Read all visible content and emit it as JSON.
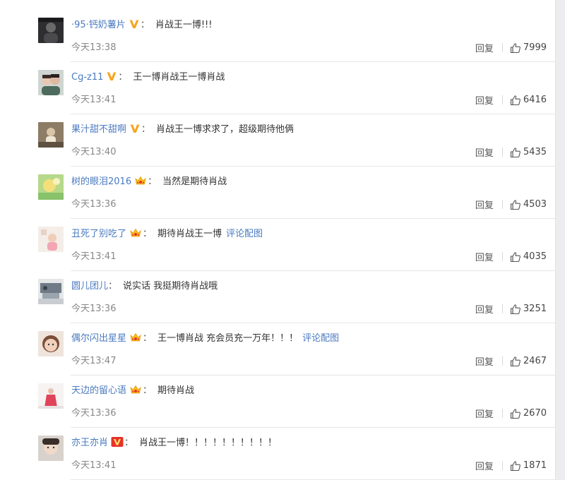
{
  "colors": {
    "link": "#4a7ac0",
    "vip_orange": "#f5a623",
    "vip_red": "#e8312a"
  },
  "icons": [
    "v-badge-icon",
    "crown-badge-icon",
    "v-red-badge-icon",
    "thumbs-up-icon"
  ],
  "actions": {
    "reply_label": "回复"
  },
  "comments": [
    {
      "username": "·95·钙奶薯片",
      "badge": "v-orange",
      "text": "肖战王一博!!!",
      "pic_link": "",
      "time": "今天13:38",
      "likes": "7999",
      "avatar": "dark"
    },
    {
      "username": "Cg-z11",
      "badge": "v-orange",
      "text": "王一博肖战王一博肖战",
      "pic_link": "",
      "time": "今天13:41",
      "likes": "6416",
      "avatar": "couple"
    },
    {
      "username": "果汁甜不甜啊",
      "badge": "v-orange",
      "text": "肖战王一博求求了，超级期待他俩",
      "pic_link": "",
      "time": "今天13:40",
      "likes": "5435",
      "avatar": "sepia"
    },
    {
      "username": "树的眼泪2016",
      "badge": "crown",
      "text": "当然是期待肖战",
      "pic_link": "",
      "time": "今天13:36",
      "likes": "4503",
      "avatar": "green"
    },
    {
      "username": "丑死了别吃了",
      "badge": "crown",
      "text": "期待肖战王一博",
      "pic_link": "评论配图",
      "time": "今天13:41",
      "likes": "4035",
      "avatar": "pink"
    },
    {
      "username": "圆儿团儿",
      "badge": "",
      "text": "说实话 我挺期待肖战哦",
      "pic_link": "",
      "time": "今天13:36",
      "likes": "3251",
      "avatar": "room"
    },
    {
      "username": "偶尔闪出星星",
      "badge": "crown",
      "text": "王一博肖战 充会员充一万年！！！",
      "pic_link": "评论配图",
      "time": "今天13:47",
      "likes": "2467",
      "avatar": "child"
    },
    {
      "username": "天边的留心语",
      "badge": "crown",
      "text": "期待肖战",
      "pic_link": "",
      "time": "今天13:36",
      "likes": "2670",
      "avatar": "figure"
    },
    {
      "username": "亦王亦肖",
      "badge": "v-red",
      "text": "肖战王一博！！！！！！！！！！",
      "pic_link": "",
      "time": "今天13:41",
      "likes": "1871",
      "avatar": "face"
    }
  ]
}
